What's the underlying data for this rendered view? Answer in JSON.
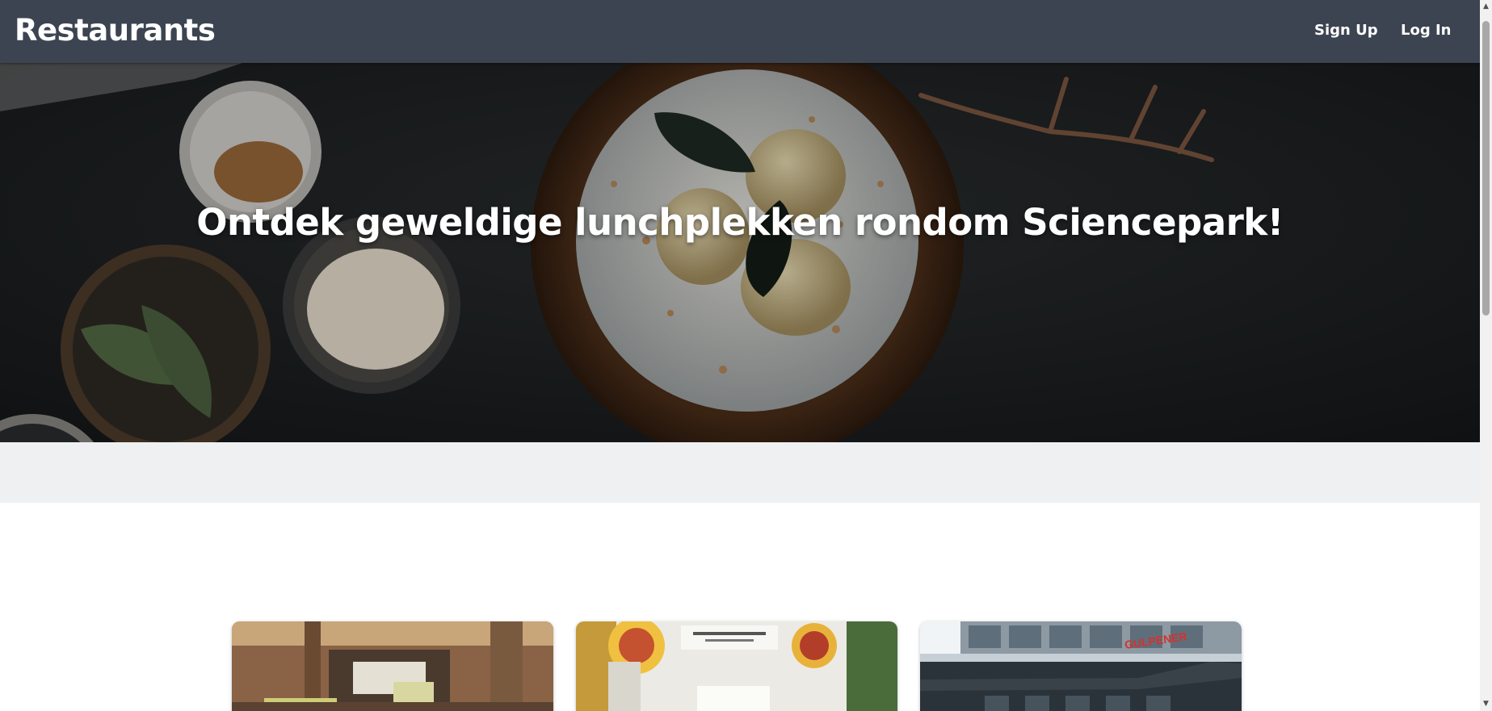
{
  "header": {
    "brand": "Restaurants",
    "signup_label": "Sign Up",
    "login_label": "Log In",
    "background_color": "#3d4451"
  },
  "hero": {
    "title": "Ontdek geweldige lunchplekken rondom Sciencepark!",
    "image": "cake-on-wooden-board-icon"
  },
  "cards": [
    {
      "image": "restaurant-interior-icon"
    },
    {
      "image": "sandwich-shop-icon"
    },
    {
      "image": "gulpener-building-icon",
      "sign_text": "GULPENER"
    }
  ],
  "colors": {
    "band": "#eff0f2",
    "background": "#ffffff"
  }
}
